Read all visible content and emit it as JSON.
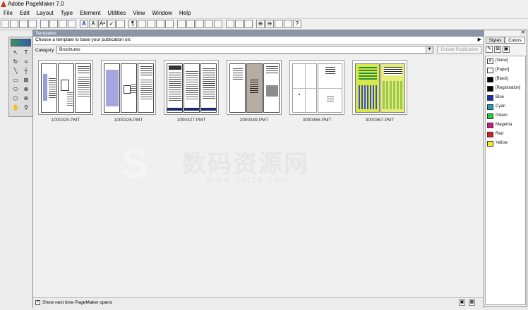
{
  "window": {
    "title": "Adobe PageMaker 7.0"
  },
  "menu": [
    "File",
    "Edit",
    "Layout",
    "Type",
    "Element",
    "Utilities",
    "View",
    "Window",
    "Help"
  ],
  "toolbar": {
    "icons": [
      "new-icon",
      "open-icon",
      "save-icon",
      "print-icon",
      "cut-icon",
      "copy-icon",
      "paste-icon",
      "undo-icon",
      "bold-icon",
      "character-icon",
      "font-size-icon",
      "spell-icon",
      "place-icon",
      "paragraph-icon",
      "indent-icon",
      "bullets-icon",
      "align-left-icon",
      "align-right-icon",
      "table-icon",
      "frame-icon",
      "image-icon",
      "link-icon",
      "export-icon",
      "lock-icon",
      "group-icon",
      "mask-icon",
      "zoom-in-icon",
      "zoom-out-icon",
      "fit-icon",
      "actual-size-icon",
      "help-icon"
    ],
    "labels": {
      "bold": "A",
      "help": "?",
      "paragraph": "¶"
    }
  },
  "tools": [
    {
      "name": "pointer-tool",
      "glyph": "↖"
    },
    {
      "name": "text-tool",
      "glyph": "T"
    },
    {
      "name": "rotate-tool",
      "glyph": "↻"
    },
    {
      "name": "crop-tool",
      "glyph": "⌗"
    },
    {
      "name": "line-tool",
      "glyph": "╲"
    },
    {
      "name": "constrained-line-tool",
      "glyph": "┼"
    },
    {
      "name": "rectangle-tool",
      "glyph": "▭"
    },
    {
      "name": "rectangle-frame-tool",
      "glyph": "⊠"
    },
    {
      "name": "ellipse-tool",
      "glyph": "⬭"
    },
    {
      "name": "ellipse-frame-tool",
      "glyph": "⊗"
    },
    {
      "name": "polygon-tool",
      "glyph": "⬡"
    },
    {
      "name": "polygon-frame-tool",
      "glyph": "⊛"
    },
    {
      "name": "hand-tool",
      "glyph": "✋"
    },
    {
      "name": "zoom-tool",
      "glyph": "⚲"
    }
  ],
  "templates": {
    "title": "Templates",
    "instruction": "Choose a template to base your publication on:",
    "category_label": "Category",
    "category_value": "Brochures",
    "create_button": "Create Publication",
    "items": [
      {
        "filename": "1000325.PMT"
      },
      {
        "filename": "1000326.PMT"
      },
      {
        "filename": "1000327.PMT"
      },
      {
        "filename": "2000349.PMT"
      },
      {
        "filename": "3000366.PMT"
      },
      {
        "filename": "3000367.PMT"
      }
    ],
    "show_next_time_label": "Show next time PageMaker opens",
    "show_next_time_checked": true
  },
  "styles_colors": {
    "tabs": [
      "Styles",
      "Colors"
    ],
    "active_tab": "Colors",
    "colors": [
      {
        "name": "[None]",
        "hex": "#ffffff"
      },
      {
        "name": "[Paper]",
        "hex": "#ffffff"
      },
      {
        "name": "[Black]",
        "hex": "#000000"
      },
      {
        "name": "[Registration]",
        "hex": "#000000"
      },
      {
        "name": "Blue",
        "hex": "#1e2fbf"
      },
      {
        "name": "Cyan",
        "hex": "#16a0c8"
      },
      {
        "name": "Green",
        "hex": "#1ecf3a"
      },
      {
        "name": "Magenta",
        "hex": "#d0168a"
      },
      {
        "name": "Red",
        "hex": "#d91c1c"
      },
      {
        "name": "Yellow",
        "hex": "#f2ee1a"
      }
    ]
  },
  "watermark": {
    "text": "数码资源网",
    "url": "www.smzy.com"
  }
}
